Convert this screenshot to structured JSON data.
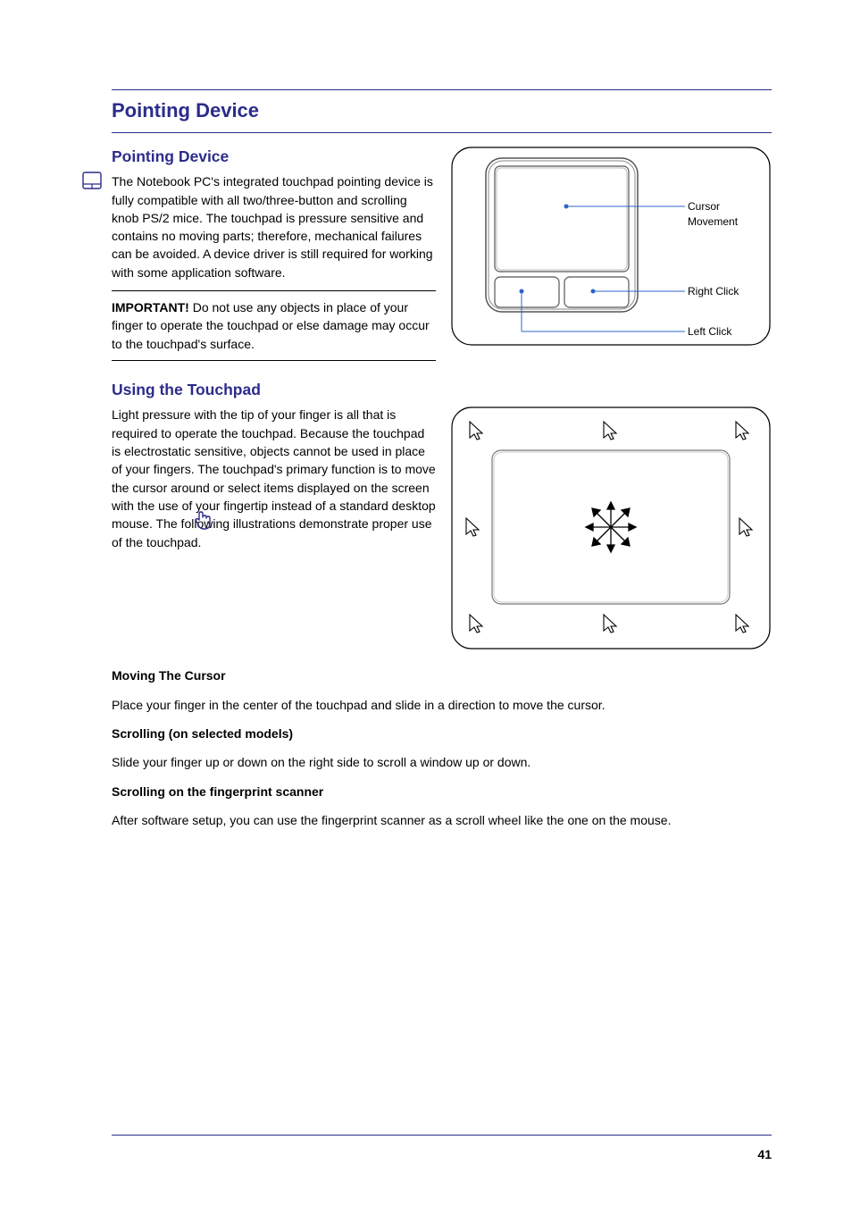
{
  "header": {
    "title": "Pointing Device"
  },
  "intro": {
    "subheading": "Pointing Device",
    "text": "The Notebook PC's integrated touchpad pointing device is fully compatible with all two/three-button and scrolling knob PS/2 mice. The touchpad is pressure sensitive and contains no moving parts; therefore, mechanical failures can be avoided. A device driver is still required for working with some application software."
  },
  "note": {
    "prefix": "IMPORTANT!",
    "text": " Do not use any objects in place of your finger to operate the touchpad or else damage may occur to the touchpad's surface."
  },
  "diagram1": {
    "label_left": "Left Click",
    "label_right": "Right Click",
    "label_cursor": "Cursor Movement"
  },
  "usage": {
    "heading": "Using the Touchpad",
    "intro": "Light pressure with the tip of your finger is all that is required to operate the touchpad. Because the touchpad is electrostatic sensitive, objects cannot be used in place of your fingers. The touchpad's primary function is to move the cursor around or select items displayed on the screen with the use of your fingertip instead of a standard desktop mouse. The following illustrations demonstrate proper use of the touchpad.",
    "moving_heading": "Moving The Cursor",
    "moving_text": "Place your finger in the center of the touchpad and slide in a direction to move the cursor.",
    "scrolling_heading": "Scrolling (on selected models)",
    "scrolling_text": "Slide your finger up or down on the right side to scroll a window up or down.",
    "scroll_pad_heading": "Scrolling on the fingerprint scanner",
    "scroll_pad_text": "After software setup, you can use the fingerprint scanner as a scroll wheel like the one on the mouse."
  },
  "footer": {
    "page": "41"
  }
}
